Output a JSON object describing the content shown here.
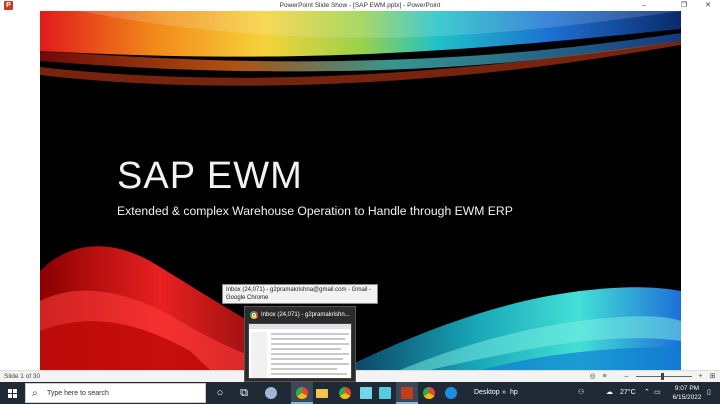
{
  "window": {
    "title": "PowerPoint Slide Show - [SAP EWM.pptx] - PowerPoint",
    "app_icon": "powerpoint-icon",
    "app_icon_letter": "P",
    "controls": [
      "–",
      "❐",
      "✕"
    ]
  },
  "slide": {
    "title": "SAP EWM",
    "subtitle": "Extended & complex Warehouse Operation to Handle through EWM ERP"
  },
  "statusbar": {
    "slide_counter": "Slide 1 of 30"
  },
  "taskbar": {
    "search_placeholder": "Type here to search",
    "desktop_label": "Desktop",
    "hp_label": "hp",
    "weather": "27°C",
    "time": "9:07 PM",
    "date": "6/15/2022",
    "pinned": [
      "cortana-icon",
      "task-view-icon",
      "cloud-icon",
      "chrome-icon",
      "file-explorer-icon",
      "chrome-icon",
      "notepad-icon",
      "photos-icon",
      "powerpoint-icon",
      "chrome-icon",
      "outlook-icon"
    ]
  },
  "tooltip": {
    "text": "Inbox (24,071) - g2pramakrishna@gmail.com - Gmail - Google Chrome"
  },
  "preview": {
    "title": "Inbox (24,071) - g2pramakrishn..."
  },
  "colors": {
    "taskbar": "#1f2a36",
    "slide_bg": "#000000",
    "accent": "#76b9ed"
  }
}
